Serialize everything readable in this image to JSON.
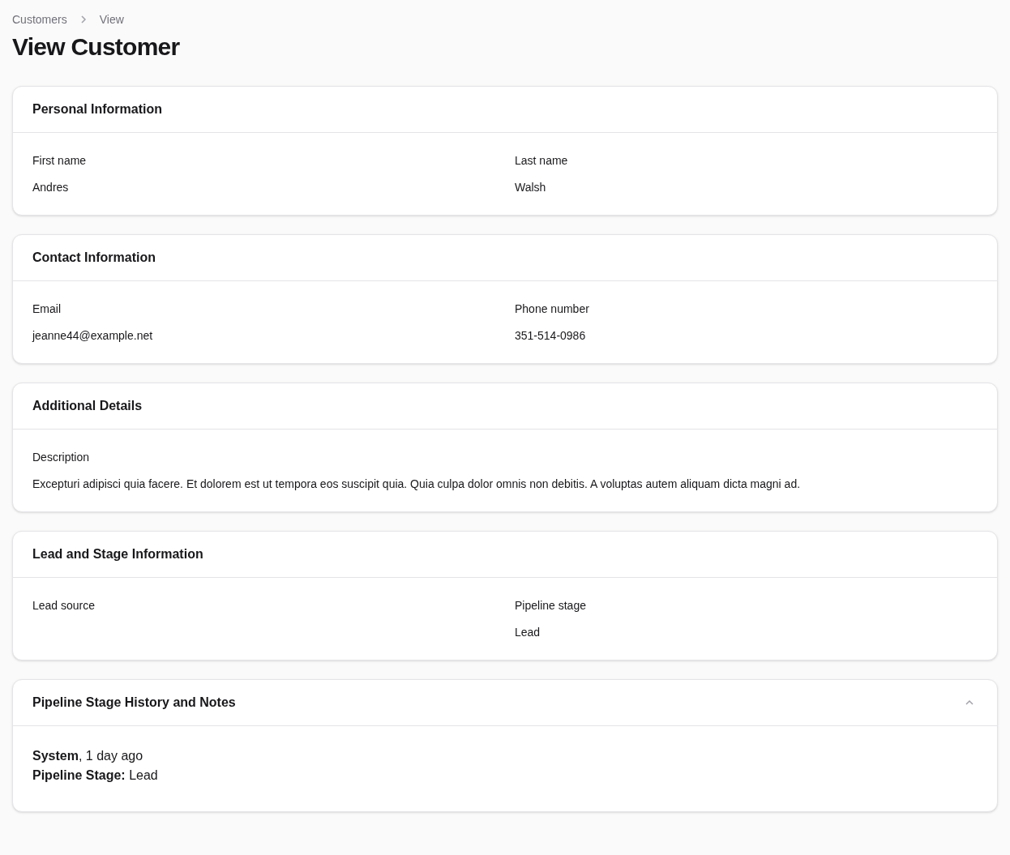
{
  "breadcrumbs": [
    {
      "label": "Customers"
    },
    {
      "label": "View"
    }
  ],
  "title": "View Customer",
  "sections": [
    {
      "title": "Personal Information",
      "fields": [
        {
          "kind": "short",
          "label": "First name",
          "value": "Andres"
        },
        {
          "kind": "short",
          "label": "Last name",
          "value": "Walsh"
        }
      ]
    },
    {
      "title": "Contact Information",
      "fields": [
        {
          "kind": "short",
          "label": "Email",
          "value": "jeanne44@example.net"
        },
        {
          "kind": "short",
          "label": "Phone number",
          "value": "351-514-0986"
        }
      ]
    },
    {
      "title": "Additional Details",
      "fields": [
        {
          "kind": "long",
          "label": "Description",
          "value": "Excepturi adipisci quia facere. Et dolorem est ut tempora eos suscipit quia. Quia culpa dolor omnis non debitis. A voluptas autem aliquam dicta magni ad."
        }
      ]
    },
    {
      "title": "Lead and Stage Information",
      "fields": [
        {
          "kind": "short",
          "label": "Lead source"
        },
        {
          "kind": "short",
          "label": "Pipeline stage",
          "value": "Lead"
        }
      ]
    },
    {
      "title": "Pipeline Stage History and Notes",
      "expanded": true,
      "notes": [
        {
          "lines": [
            "**System**, 1 day ago",
            "**Pipeline Stage:** Lead"
          ]
        }
      ]
    }
  ]
}
